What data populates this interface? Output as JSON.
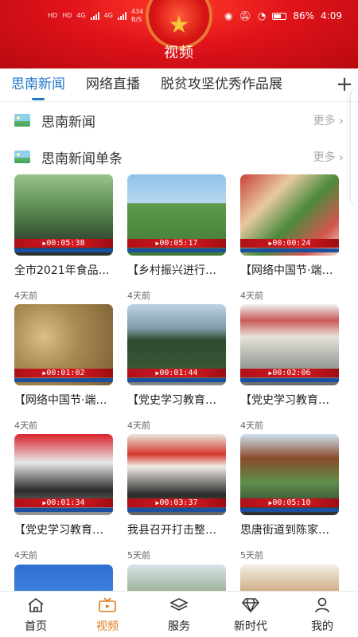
{
  "status_bar": {
    "left_text_1": "HD",
    "left_text_2": "HD",
    "signal_1": "4G",
    "signal_2": "4G",
    "speed": "434",
    "speed_unit": "B/S",
    "battery": "86%",
    "time": "4:09"
  },
  "header": {
    "title": "视频"
  },
  "tabs": {
    "items": [
      {
        "label": "思南新闻",
        "active": true
      },
      {
        "label": "网络直播",
        "active": false
      },
      {
        "label": "脱贫攻坚优秀作品展",
        "active": false
      }
    ],
    "add_label": "+"
  },
  "sections": [
    {
      "title": "思南新闻",
      "more": "更多"
    },
    {
      "title": "思南新闻单条",
      "more": "更多"
    }
  ],
  "videos": [
    {
      "title": "全市2021年食品安全...",
      "duration": "00:05:38",
      "time": "4天前",
      "scene": "forest"
    },
    {
      "title": "【乡村振兴进行时】...",
      "duration": "00:05:17",
      "time": "4天前",
      "scene": "field"
    },
    {
      "title": "【网络中国节·端午】...",
      "duration": "00:00:24",
      "time": "4天前",
      "scene": "market"
    },
    {
      "title": "【网络中国节·端午】...",
      "duration": "00:01:02",
      "time": "4天前",
      "scene": "food"
    },
    {
      "title": "【党史学习教育】...",
      "duration": "00:01:44",
      "time": "4天前",
      "scene": "soldiers"
    },
    {
      "title": "【党史学习教育】...",
      "duration": "00:02:06",
      "time": "4天前",
      "scene": "monument"
    },
    {
      "title": "【党史学习教育】...",
      "duration": "00:01:34",
      "time": "4天前",
      "scene": "group"
    },
    {
      "title": "我县召开打击整治...",
      "duration": "00:03:37",
      "time": "5天前",
      "scene": "meeting"
    },
    {
      "title": "思唐街道到陈家寨...",
      "duration": "00:05:10",
      "time": "5天前",
      "scene": "village"
    },
    {
      "title": "",
      "duration": "",
      "time": "",
      "scene": "blue"
    },
    {
      "title": "",
      "duration": "",
      "time": "",
      "scene": "hill"
    },
    {
      "title": "",
      "duration": "",
      "time": "",
      "scene": "classroom"
    }
  ],
  "bottom_nav": [
    {
      "label": "首页",
      "icon": "home-icon",
      "active": false
    },
    {
      "label": "视频",
      "icon": "video-icon",
      "active": true
    },
    {
      "label": "服务",
      "icon": "layers-icon",
      "active": false
    },
    {
      "label": "新时代",
      "icon": "diamond-icon",
      "active": false
    },
    {
      "label": "我的",
      "icon": "user-icon",
      "active": false
    }
  ],
  "colors": {
    "accent": "#1f78c8",
    "header_red": "#e0121a",
    "nav_active": "#e07b1a"
  }
}
